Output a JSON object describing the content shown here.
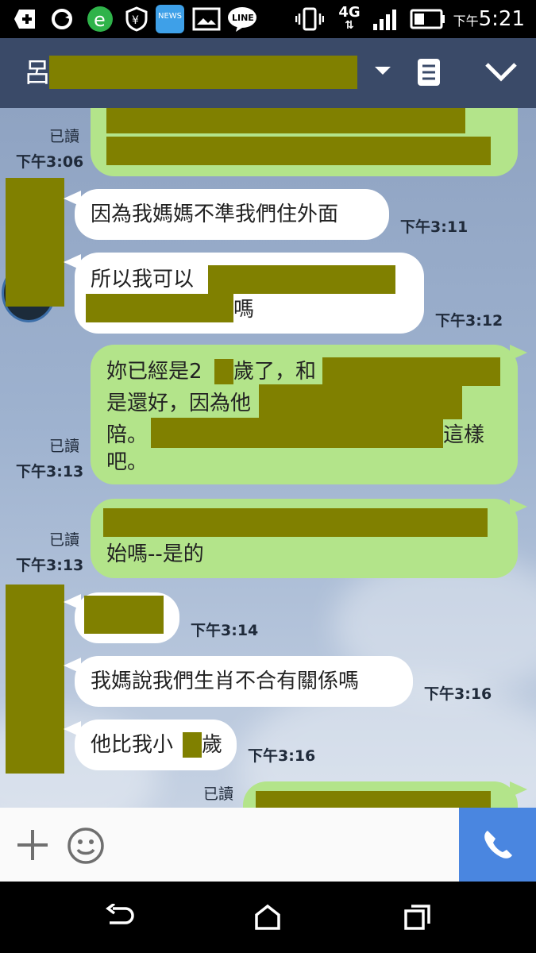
{
  "status_bar": {
    "ampm": "下午",
    "time": "5:21",
    "network": "4G",
    "icons": [
      "add-icon",
      "sync-icon",
      "browser-icon",
      "shield-icon",
      "news-icon",
      "gallery-icon",
      "line-icon",
      "vibrate-icon",
      "signal-icon",
      "battery-icon"
    ],
    "news_label": "NEWS",
    "line_label": "LINE"
  },
  "header": {
    "contact_name_initial": "呂"
  },
  "messages": [
    {
      "read": "已讀",
      "time": "下午3:06"
    },
    {
      "text": "因為我媽媽不準我們住外面",
      "time": "下午3:11"
    },
    {
      "text1": "所以我可以",
      "text1_tail": "嗎",
      "time": "下午3:12"
    },
    {
      "read": "已讀",
      "line1": "妳已經是2",
      "line1b": "歲了，和",
      "line2": "是還好，因為他",
      "line3": "陪。",
      "line3b": "這樣",
      "line4": "吧。",
      "time": "下午3:13"
    },
    {
      "read": "已讀",
      "text": "始嗎--是的",
      "time": "下午3:13"
    },
    {
      "time": "下午3:14"
    },
    {
      "text": "我媽說我們生肖不合有關係嗎",
      "time": "下午3:16"
    },
    {
      "text": "他比我小",
      "text_tail": "歲",
      "time": "下午3:16"
    },
    {
      "read": "已讀"
    }
  ],
  "colors": {
    "header_bg": "#3a4a68",
    "outgoing_bubble": "#b3e48a",
    "incoming_bubble": "#ffffff",
    "redaction": "#808000",
    "call_button": "#4a86e0"
  }
}
